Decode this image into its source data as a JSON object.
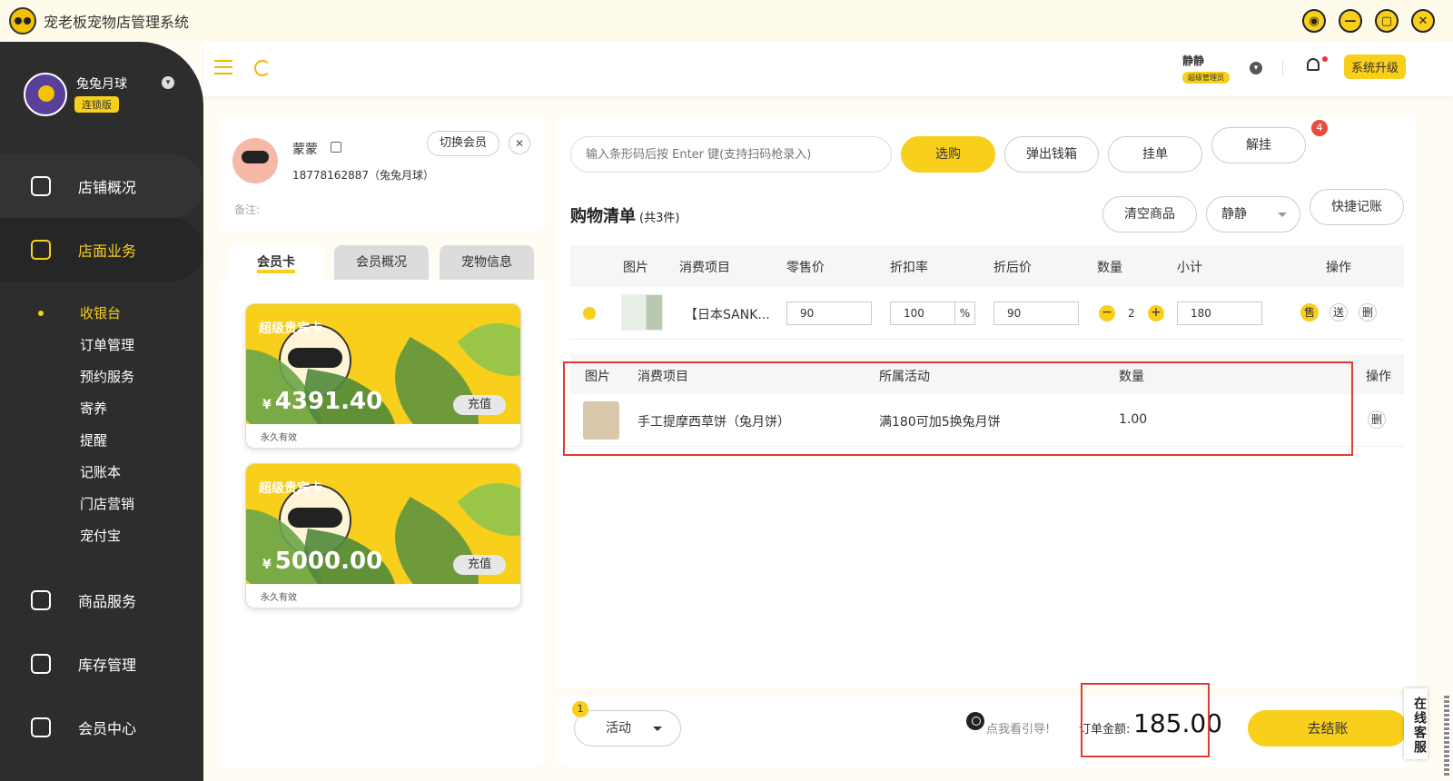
{
  "app": {
    "title": "宠老板宠物店管理系统",
    "window_controls": [
      "settings-icon",
      "minimize-icon",
      "maximize-icon",
      "close-icon"
    ]
  },
  "sidebar": {
    "user_name": "兔兔月球",
    "edition": "连锁版",
    "items": [
      {
        "label": "店铺概况",
        "icon": "monitor-icon"
      },
      {
        "label": "店面业务",
        "icon": "home-icon",
        "active": true
      },
      {
        "label": "商品服务",
        "icon": "bag-icon"
      },
      {
        "label": "库存管理",
        "icon": "box-icon"
      },
      {
        "label": "会员中心",
        "icon": "member-icon"
      }
    ],
    "sub_items": [
      "收银台",
      "订单管理",
      "预约服务",
      "寄养",
      "提醒",
      "记账本",
      "门店营销",
      "宠付宝"
    ]
  },
  "topbar": {
    "user": "静静",
    "role": "超级管理员",
    "upgrade": "系统升级"
  },
  "member": {
    "name": "蒙蒙",
    "phone": "18778162887（兔兔月球）",
    "note_label": "备注:",
    "switch_label": "切换会员",
    "close": "✕"
  },
  "tabs": [
    "会员卡",
    "会员概况",
    "宠物信息"
  ],
  "cards": [
    {
      "title": "超级贵宾卡",
      "currency": "¥",
      "balance": "4391.40",
      "recharge": "充值",
      "validity": "永久有效"
    },
    {
      "title": "超级贵宾卡",
      "currency": "¥",
      "balance": "5000.00",
      "recharge": "充值",
      "validity": "永久有效"
    }
  ],
  "toolbar": {
    "barcode_placeholder": "输入条形码后按 Enter 键(支持扫码枪录入)",
    "select_btn": "选购",
    "cashbox_btn": "弹出钱箱",
    "hold_btn": "挂单",
    "release_btn": "解挂",
    "release_badge": "4"
  },
  "cart": {
    "title": "购物清单",
    "count": "(共3件)",
    "clear_btn": "清空商品",
    "staff": "静静",
    "quick_btn": "快捷记账",
    "columns": [
      "图片",
      "消费项目",
      "零售价",
      "折扣率",
      "折后价",
      "数量",
      "小计",
      "操作"
    ],
    "rows": [
      {
        "name": "【日本SANK...",
        "price": "90",
        "discount": "100",
        "pct": "%",
        "final": "90",
        "minus": "−",
        "qty": "2",
        "plus": "+",
        "subtotal": "180",
        "op_sell": "售",
        "op_gift": "送",
        "op_del": "删"
      }
    ]
  },
  "gift": {
    "columns": [
      "图片",
      "消费项目",
      "所属活动",
      "数量",
      "操作"
    ],
    "rows": [
      {
        "name": "手工提摩西草饼（兔月饼）",
        "activity": "满180可加5换兔月饼",
        "qty": "1.00",
        "op_del": "删"
      }
    ]
  },
  "bottom": {
    "activity_num": "1",
    "activity": "活动",
    "guide": "点我看引导!",
    "order_label": "订单金额:",
    "order_amount": "185.00",
    "checkout": "去结账"
  },
  "service": "在线客服"
}
